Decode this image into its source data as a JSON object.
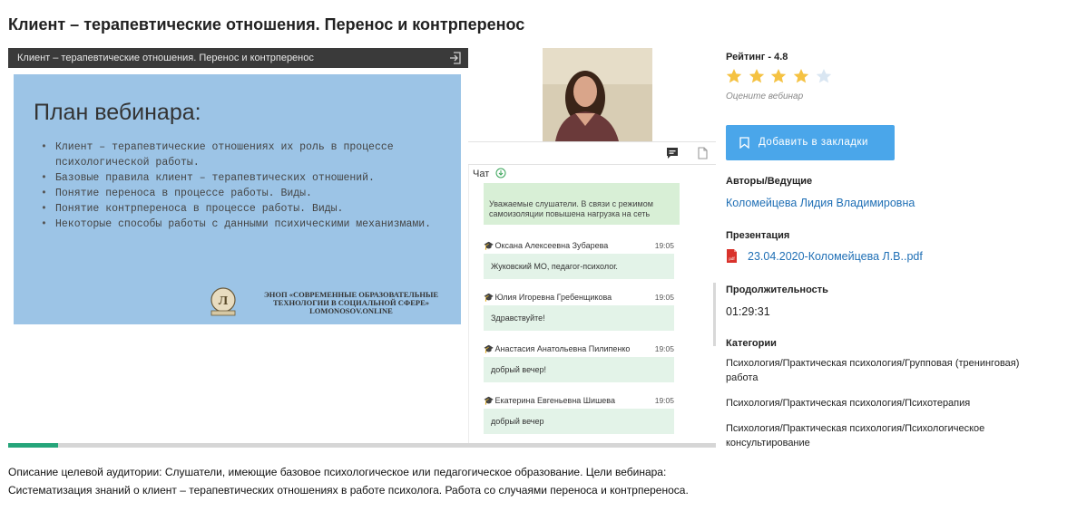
{
  "page": {
    "title": "Клиент – терапевтические отношения. Перенос и контрперенос"
  },
  "player": {
    "slide_bar_title": "Клиент – терапевтические отношения. Перенос и контрперенос",
    "slide": {
      "heading": "План вебинара:",
      "bullets": [
        "Клиент – терапевтические отношениях их роль в процессе психологической работы.",
        "Базовые правила клиент – терапевтических отношений.",
        "Понятие переноса в процессе работы. Виды.",
        "Понятие контрпереноса в процессе работы. Виды.",
        "Некоторые способы работы с данными психическими механизмами."
      ],
      "logo_text_line1": "ЭНОП «СОВРЕМЕННЫЕ ОБРАЗОВАТЕЛЬНЫЕ",
      "logo_text_line2": "ТЕХНОЛОГИИ В СОЦИАЛЬНОЙ СФЕРЕ»",
      "logo_text_line3": "LOMONOSOV.ONLINE"
    },
    "progress_fraction": 0.07
  },
  "chat": {
    "label": "Чат",
    "notice": "Уважаемые слушатели. В связи с режимом самоизоляции повышена нагрузка на сеть",
    "messages": [
      {
        "author": "Оксана Алексеевна Зубарева",
        "time": "19:05",
        "text": "Жуковский МО, педагог-психолог."
      },
      {
        "author": "Юлия Игоревна Гребенщикова",
        "time": "19:05",
        "text": "Здравствуйте!"
      },
      {
        "author": "Анастасия Анатольевна Пилипенко",
        "time": "19:05",
        "text": "добрый вечер!"
      },
      {
        "author": "Екатерина Евгеньевна Шишева",
        "time": "19:05",
        "text": "добрый вечер"
      }
    ]
  },
  "sidebar": {
    "rating_label": "Рейтинг - 4.8",
    "rating_value": 4.8,
    "rating_filled_stars": 4,
    "rating_max": 5,
    "rate_hint": "Оцените вебинар",
    "bookmark_label": "Добавить в закладки",
    "authors_title": "Авторы/Ведущие",
    "author_name": "Коломейцева Лидия Владимировна",
    "presentation_title": "Презентация",
    "presentation_file": "23.04.2020-Коломейцева Л.В..pdf",
    "pdf_icon_text": "pdf",
    "duration_title": "Продолжительность",
    "duration_value": "01:29:31",
    "categories_title": "Категории",
    "categories": [
      "Психология/Практическая психология/Групповая (тренинговая) работа",
      "Психология/Практическая психология/Психотерапия",
      "Психология/Практическая психология/Психологическое консультирование"
    ]
  },
  "description": {
    "text": "Описание целевой аудитории: Слушатели, имеющие базовое психологическое или педагогическое образование. Цели вебинара: Систематизация знаний о клиент – терапевтических отношениях в работе психолога. Работа со случаями переноса и контрпереноса."
  },
  "colors": {
    "accent": "#4aa6ea",
    "link": "#1f6fb5",
    "star_filled": "#f5c242",
    "star_empty": "#d9e6f2",
    "slide_bg": "#9cc4e6",
    "progress": "#25a57a",
    "chat_bubble": "#e3f3e8"
  }
}
